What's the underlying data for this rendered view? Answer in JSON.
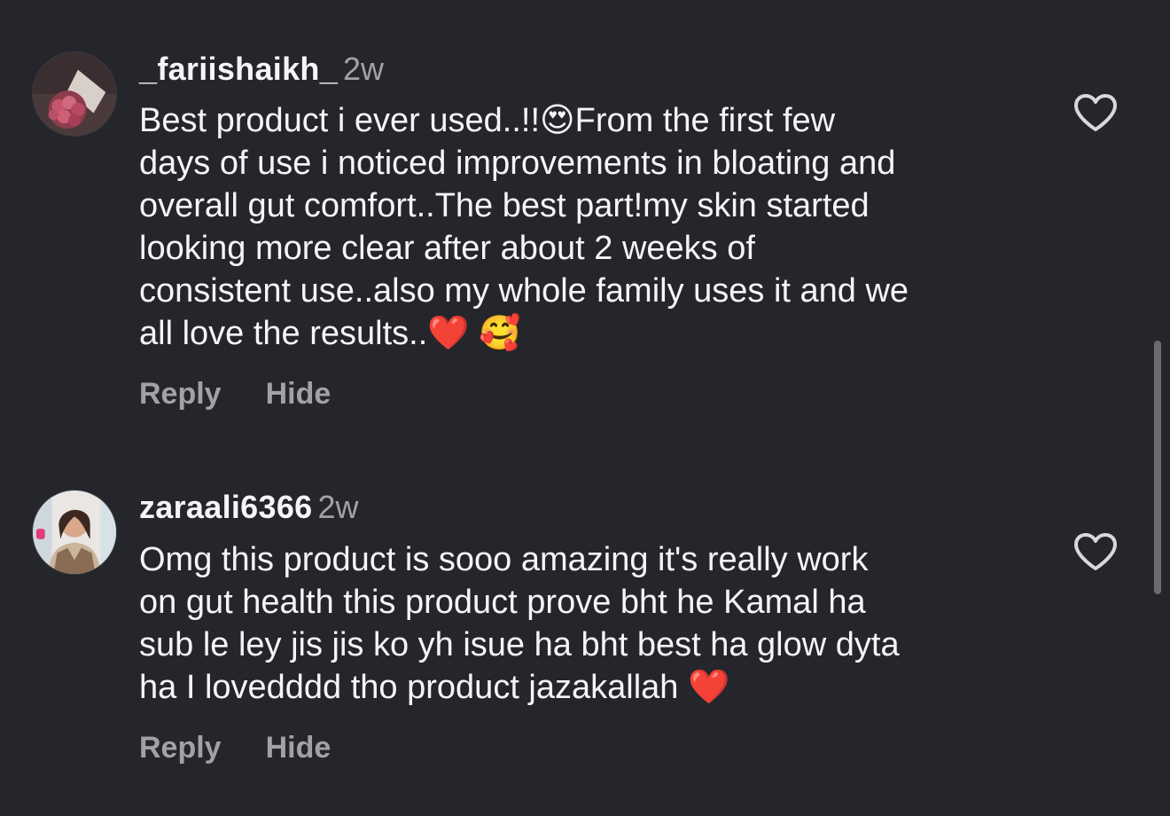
{
  "comments": [
    {
      "username": "_fariishaikh_",
      "time": "2w",
      "text": "Best product i ever used..!!😍From the first few\ndays of use i noticed improvements in bloating and\noverall gut comfort..The best part!my skin started\nlooking more clear after about 2 weeks of\nconsistent use..also my whole family uses it and we\nall love the results..❤️ 🥰",
      "reply_label": "Reply",
      "hide_label": "Hide",
      "like_icon": "heart-outline-icon",
      "avatar": "avatar-flowers"
    },
    {
      "username": "zaraali6366",
      "time": "2w",
      "text": "Omg this product is sooo amazing it's really work\non gut health  this product prove bht he Kamal ha\nsub le ley jis jis ko yh isue ha bht best ha glow dyta\nha I lovedddd tho product jazakallah ❤️",
      "reply_label": "Reply",
      "hide_label": "Hide",
      "like_icon": "heart-outline-icon",
      "avatar": "avatar-person"
    }
  ],
  "colors": {
    "background": "#25262b",
    "text": "#f5f5f7",
    "muted": "#a1a1a8",
    "icon": "#d9d9dd"
  }
}
